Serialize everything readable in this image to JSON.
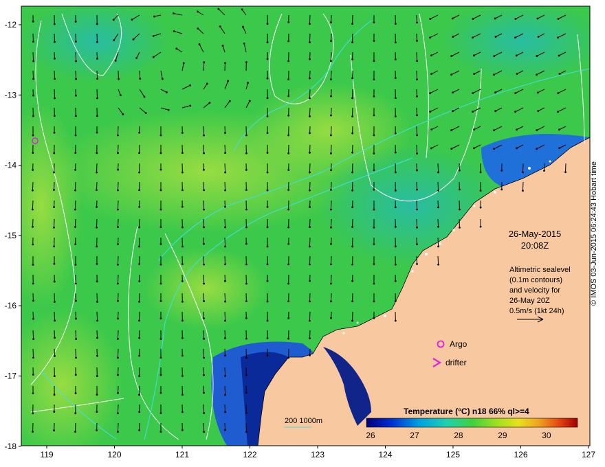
{
  "map": {
    "lon_ticks": [
      "119",
      "120",
      "121",
      "122",
      "123",
      "124",
      "125",
      "126",
      "127"
    ],
    "lat_ticks": [
      "-12",
      "-13",
      "-14",
      "-15",
      "-16",
      "-17",
      "-18"
    ],
    "lon_range": [
      118.65,
      127.0
    ],
    "lat_range": [
      -11.85,
      -18.0
    ]
  },
  "info": {
    "date": "26-May-2015",
    "time": "20:08Z",
    "legend_lines": [
      "Altimetric sealevel",
      "(0.1m contours)",
      "and velocity for",
      "26-May 20Z",
      "0.5m/s (1kt 24h)"
    ]
  },
  "markers": {
    "argo_label": "Argo",
    "drifter_label": "drifter"
  },
  "bathymetry": {
    "label": "200  1000m"
  },
  "colorbar": {
    "title": "Temperature (°C) n18 66% ql>=4",
    "ticks": [
      "26",
      "27",
      "28",
      "29",
      "30"
    ],
    "range": [
      26,
      30.8
    ]
  },
  "credit": "© IMOS 03-Jun-2015 06:24:43 Hobart time",
  "colors": {
    "land": "#f8c8a0",
    "sst_warm": "#3fcf4a",
    "sst_cool": "#1d66d6",
    "argo": "#e020e0",
    "contour": "#ffffff",
    "bathy": "#40e0e0"
  }
}
